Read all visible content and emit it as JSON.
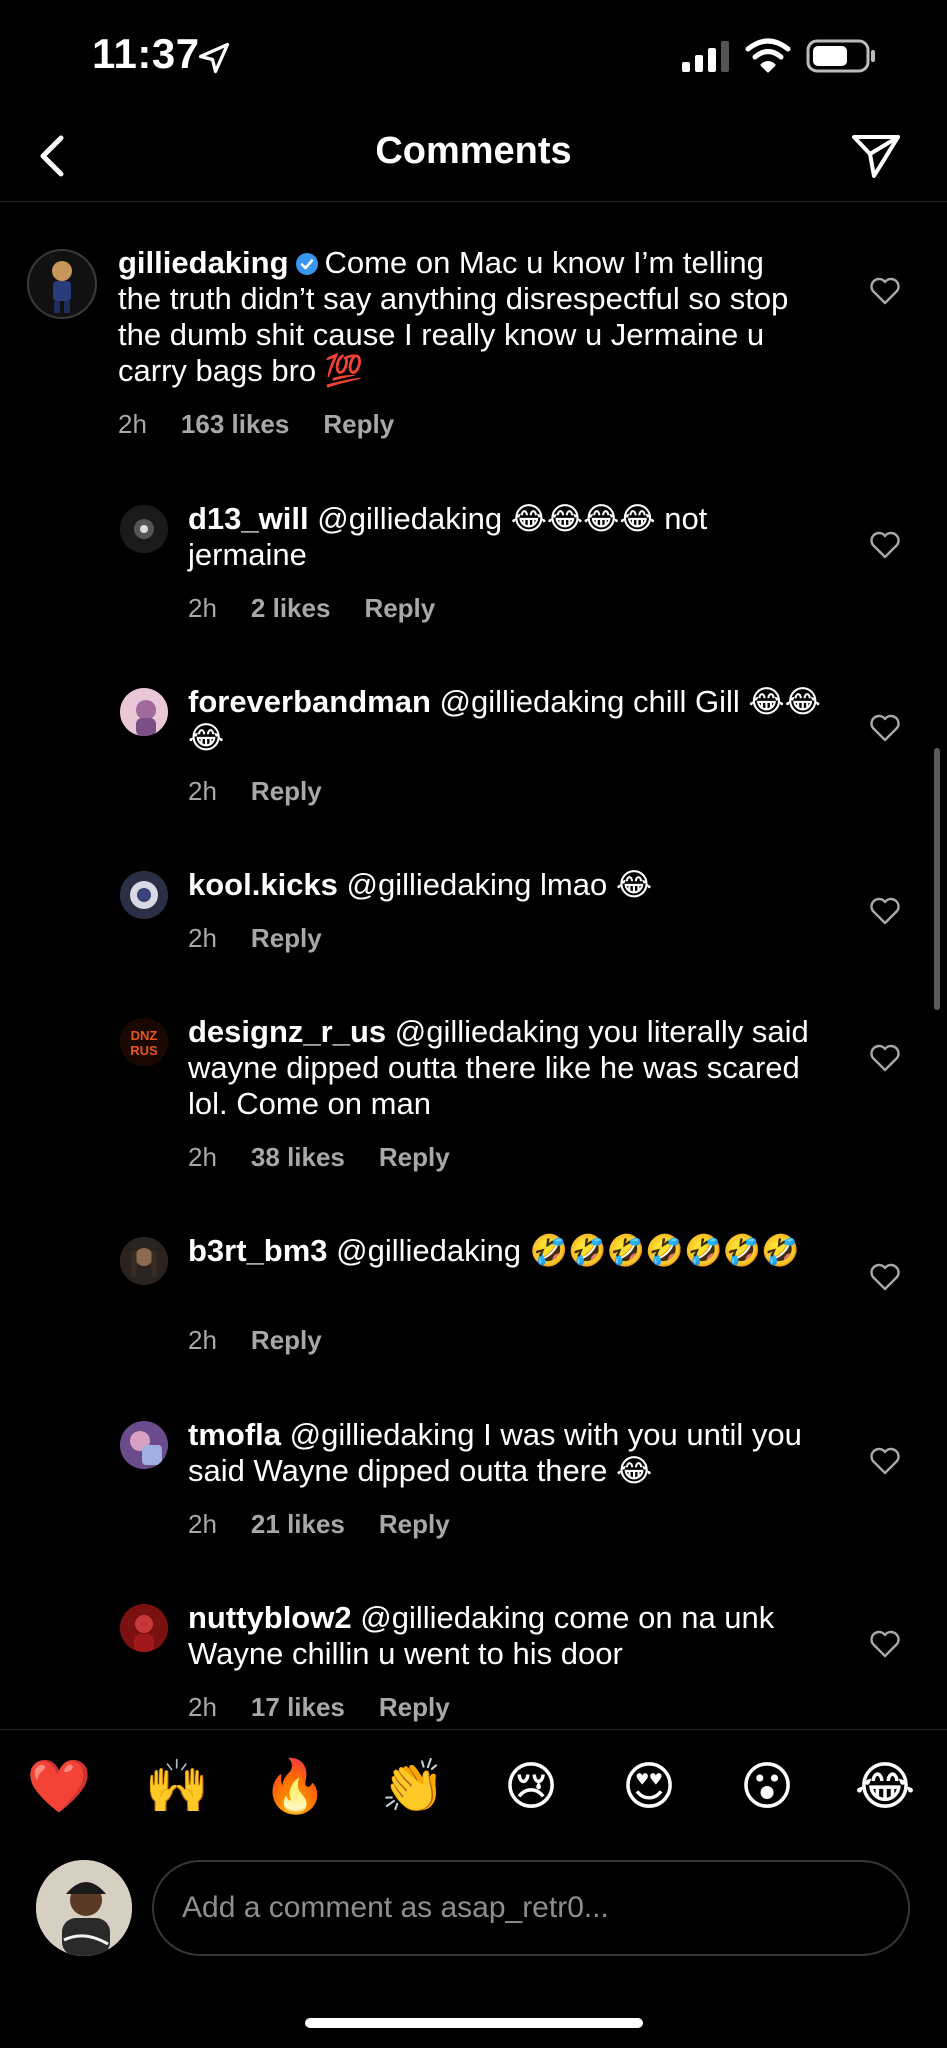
{
  "status_bar": {
    "time": "11:37"
  },
  "header": {
    "title": "Comments"
  },
  "comments": [
    {
      "username": "gilliedaking",
      "verified": true,
      "text": "Come on Mac u know I’m telling the truth didn’t say anything disrespectful so stop the dumb shit cause I really know u Jermaine u carry bags bro 💯",
      "time": "2h",
      "likes": "163 likes",
      "reply": "Reply"
    },
    {
      "username": "d13_will",
      "text": "@gilliedaking 😂😂😂😂 not jermaine",
      "time": "2h",
      "likes": "2 likes",
      "reply": "Reply"
    },
    {
      "username": "foreverbandman",
      "text": "@gilliedaking chill Gill 😂😂😂",
      "time": "2h",
      "likes": "",
      "reply": "Reply"
    },
    {
      "username": "kool.kicks",
      "text": "@gilliedaking lmao 😂",
      "time": "2h",
      "likes": "",
      "reply": "Reply"
    },
    {
      "username": "designz_r_us",
      "text": "@gilliedaking you literally said wayne dipped outta there like he was scared lol. Come on man",
      "time": "2h",
      "likes": "38 likes",
      "reply": "Reply"
    },
    {
      "username": "b3rt_bm3",
      "text": "@gilliedaking 🤣🤣🤣🤣🤣🤣🤣",
      "time": "2h",
      "likes": "",
      "reply": "Reply"
    },
    {
      "username": "tmofla",
      "text": "@gilliedaking I was with you until you said Wayne dipped outta there 😂",
      "time": "2h",
      "likes": "21 likes",
      "reply": "Reply"
    },
    {
      "username": "nuttyblow2",
      "text": "@gilliedaking come on na unk Wayne chillin u went to his door",
      "time": "2h",
      "likes": "17 likes",
      "reply": "Reply"
    }
  ],
  "reactions": [
    "❤️",
    "🙌",
    "🔥",
    "👏",
    "😢",
    "😍",
    "😮",
    "😂"
  ],
  "composer": {
    "placeholder": "Add a comment as asap_retr0..."
  },
  "colors": {
    "background": "#000000",
    "meta_text": "#a8a8a8",
    "verified": "#3897f0"
  }
}
